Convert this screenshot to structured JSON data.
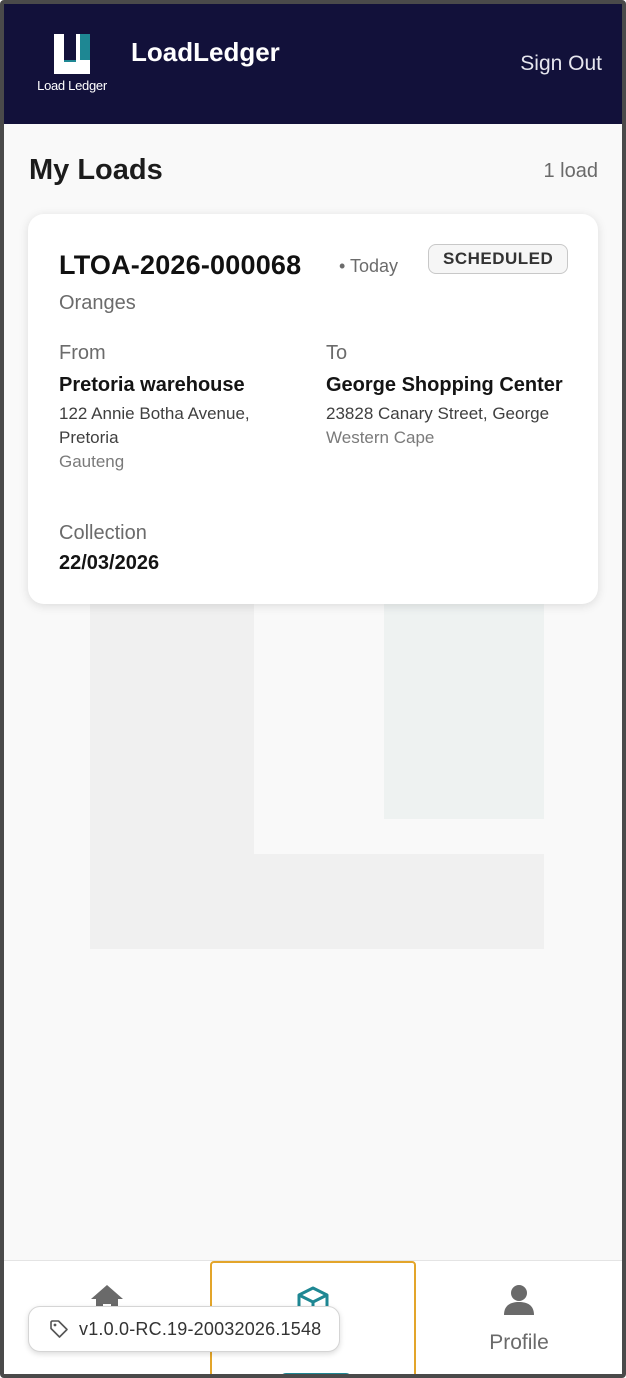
{
  "header": {
    "app_title": "LoadLedger",
    "logo_text": "Load Ledger",
    "sign_out_label": "Sign Out"
  },
  "page": {
    "title": "My Loads",
    "count_label": "1 load"
  },
  "loads": [
    {
      "id": "LTOA-2026-000068",
      "when": "• Today",
      "status": "SCHEDULED",
      "product": "Oranges",
      "from_label": "From",
      "from_name": "Pretoria warehouse",
      "from_address": "122 Annie Botha Avenue, Pretoria",
      "from_province": "Gauteng",
      "to_label": "To",
      "to_name": "George Shopping Center",
      "to_address": "23828 Canary Street, George",
      "to_province": "Western Cape",
      "collection_label": "Collection",
      "collection_date": "22/03/2026"
    }
  ],
  "nav": {
    "items": [
      {
        "label": "",
        "icon": "home-icon",
        "active": false
      },
      {
        "label": "",
        "icon": "box-icon",
        "active": true
      },
      {
        "label": "Profile",
        "icon": "person-icon",
        "active": false
      }
    ]
  },
  "version": {
    "label": "v1.0.0-RC.19-20032026.1548",
    "icon": "tag-icon"
  },
  "colors": {
    "header_bg": "#12113a",
    "accent": "#1e8793",
    "focus_outline": "#e3a52a"
  }
}
